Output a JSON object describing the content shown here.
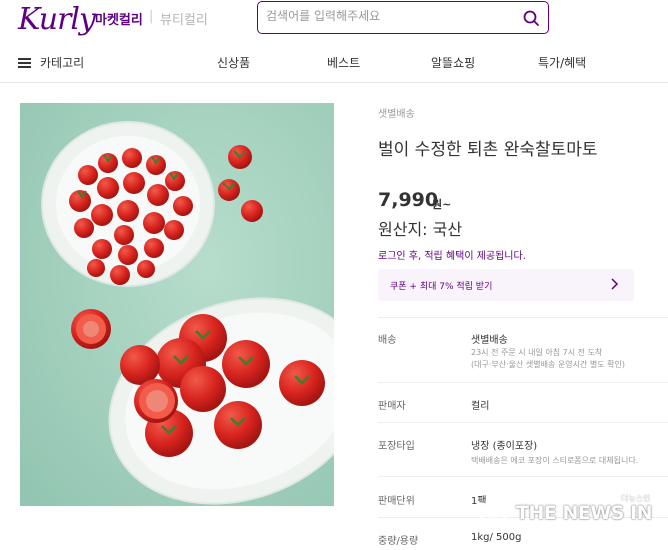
{
  "header": {
    "logo": "Kurly",
    "tab_market": "마켓컬리",
    "tab_sep": "|",
    "tab_beauty": "뷰티컬리",
    "search_placeholder": "검색어를 입력해주세요"
  },
  "gnb": {
    "category": "카테고리",
    "menu": [
      "신상품",
      "베스트",
      "알뜰쇼핑",
      "특가/혜택"
    ]
  },
  "product": {
    "delivery_type": "샛별배송",
    "title": "벌이 수정한 퇴촌 완숙찰토마토",
    "price": "7,990",
    "price_unit": "원~",
    "origin": "원산지: 국산",
    "login_notice": "로그인 후, 적립 혜택이 제공됩니다.",
    "coupon": "쿠폰 + 최대 7% 적립 받기"
  },
  "details": {
    "delivery_label": "배송",
    "delivery_value": "샛별배송",
    "delivery_sub1": "23시 전 주문 시 내일 아침 7시 전 도착",
    "delivery_sub2": "(대구·부산·울산 샛별배송 운영시간 별도 확인)",
    "seller_label": "판매자",
    "seller_value": "컬리",
    "packaging_label": "포장타입",
    "packaging_value": "냉장 (종이포장)",
    "packaging_sub": "택배배송은 에코 포장이 스티로폼으로 대체됩니다.",
    "unit_label": "판매단위",
    "unit_value": "1팩",
    "weight_label": "중량/용량",
    "weight_value": "1kg/ 500g"
  },
  "watermark": {
    "text": "THE NEWS IN",
    "small": "더뉴스인"
  },
  "colors": {
    "brand": "#5f0080",
    "image_bg": "#a8d3c1",
    "tomato": "#d8241f"
  }
}
